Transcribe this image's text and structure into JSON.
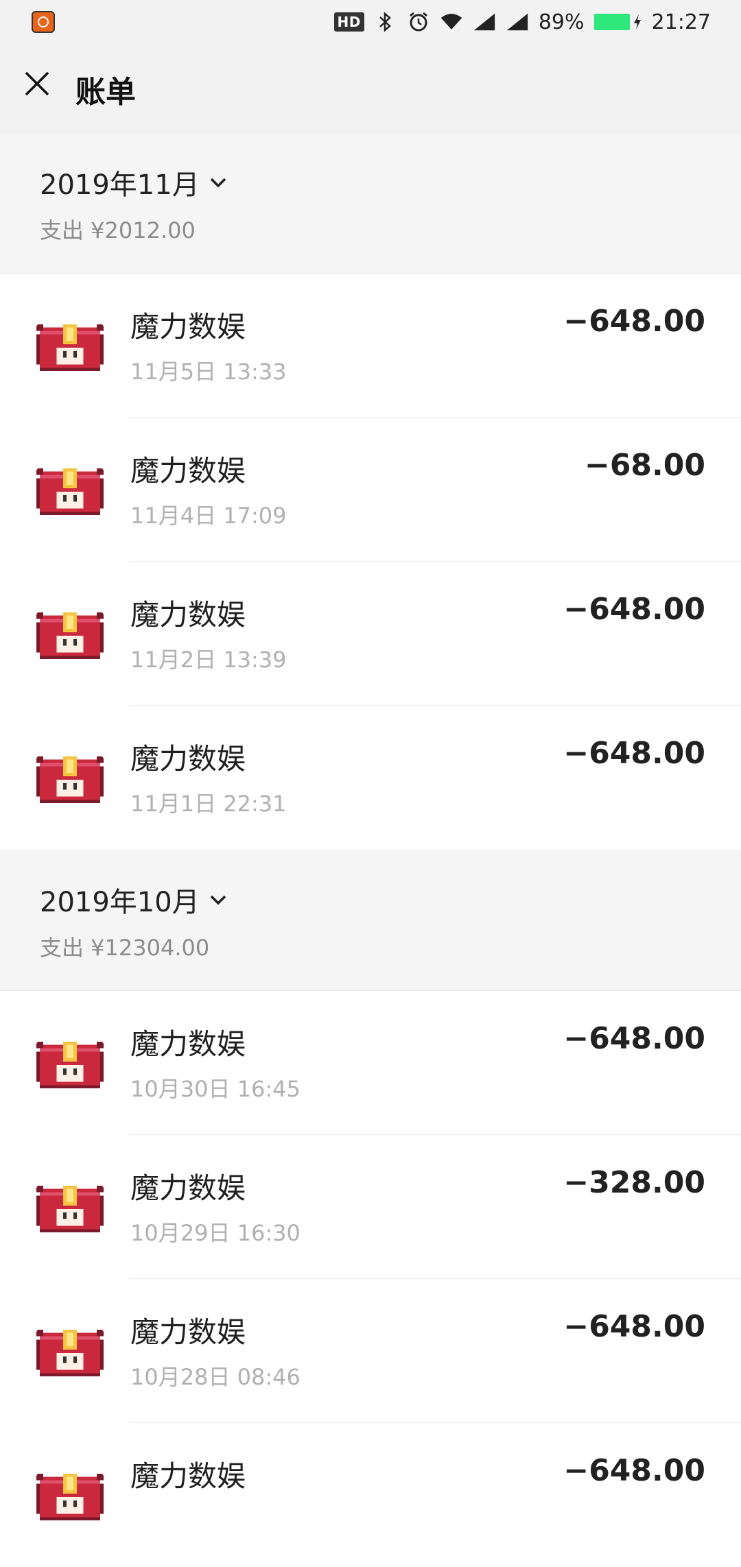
{
  "status_bar": {
    "hd_label": "HD",
    "battery_percent": "89%",
    "time": "21:27",
    "battery_color": "#2ee87e"
  },
  "header": {
    "title": "账单",
    "close_icon": "close-icon"
  },
  "months": [
    {
      "title": "2019年11月",
      "expense": "支出 ¥2012.00",
      "items": [
        {
          "name": "魔力数娱",
          "time": "11月5日 13:33",
          "amount": "−648.00"
        },
        {
          "name": "魔力数娱",
          "time": "11月4日 17:09",
          "amount": "−68.00"
        },
        {
          "name": "魔力数娱",
          "time": "11月2日 13:39",
          "amount": "−648.00"
        },
        {
          "name": "魔力数娱",
          "time": "11月1日 22:31",
          "amount": "−648.00"
        }
      ]
    },
    {
      "title": "2019年10月",
      "expense": "支出 ¥12304.00",
      "items": [
        {
          "name": "魔力数娱",
          "time": "10月30日 16:45",
          "amount": "−648.00"
        },
        {
          "name": "魔力数娱",
          "time": "10月29日 16:30",
          "amount": "−328.00"
        },
        {
          "name": "魔力数娱",
          "time": "10月28日 08:46",
          "amount": "−648.00"
        },
        {
          "name": "魔力数娱",
          "time": "",
          "amount": "−648.00"
        }
      ]
    }
  ]
}
